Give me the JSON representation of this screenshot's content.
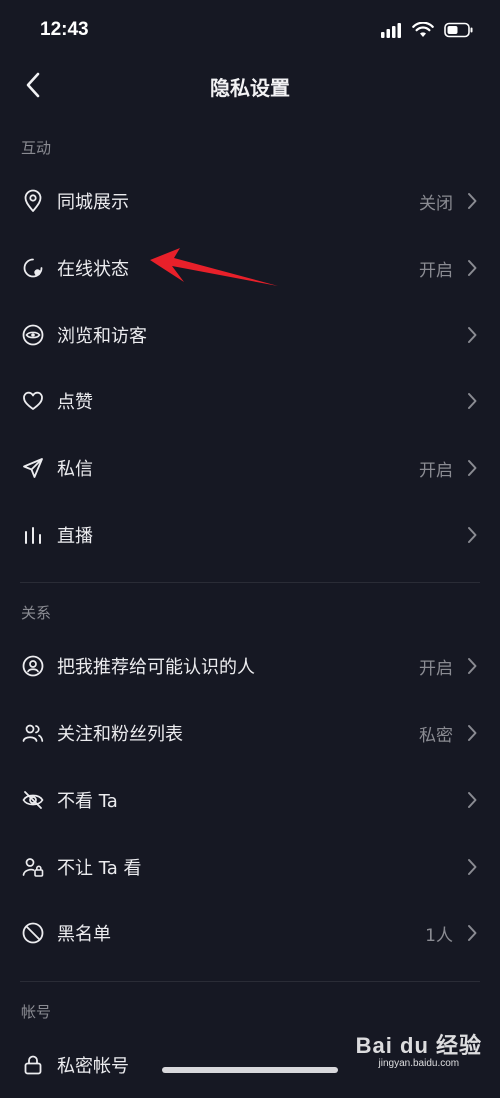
{
  "status": {
    "time": "12:43"
  },
  "header": {
    "title": "隐私设置"
  },
  "sections": [
    {
      "title": "互动",
      "items": [
        {
          "label": "同城展示",
          "value": "关闭"
        },
        {
          "label": "在线状态",
          "value": "开启"
        },
        {
          "label": "浏览和访客",
          "value": ""
        },
        {
          "label": "点赞",
          "value": ""
        },
        {
          "label": "私信",
          "value": "开启"
        },
        {
          "label": "直播",
          "value": ""
        }
      ]
    },
    {
      "title": "关系",
      "items": [
        {
          "label": "把我推荐给可能认识的人",
          "value": "开启"
        },
        {
          "label": "关注和粉丝列表",
          "value": "私密"
        },
        {
          "label": "不看 Ta",
          "value": ""
        },
        {
          "label": "不让 Ta 看",
          "value": ""
        },
        {
          "label": "黑名单",
          "value": "1人"
        }
      ]
    },
    {
      "title": "帐号",
      "items": [
        {
          "label": "私密帐号",
          "value": ""
        }
      ]
    }
  ],
  "watermark": {
    "brand": "Bai du 经验",
    "url": "jingyan.baidu.com"
  },
  "colors": {
    "background": "#161823",
    "annotation_arrow": "#e8202a"
  }
}
